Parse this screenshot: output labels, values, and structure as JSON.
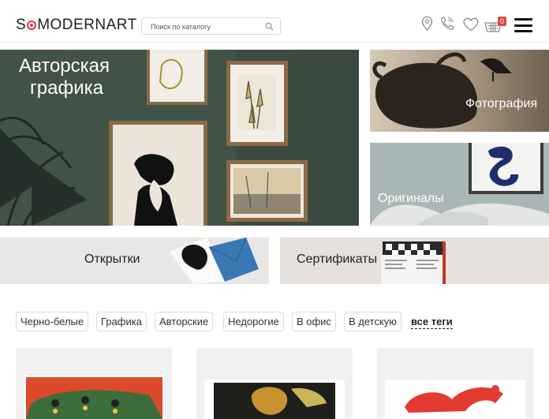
{
  "header": {
    "logo_pre": "S",
    "logo_post": "MODERNART",
    "search_placeholder": "Поиск по каталогу",
    "cart_count": "0",
    "icons": [
      "location-icon",
      "phone-icon",
      "heart-icon",
      "cart-icon",
      "menu-icon",
      "search-icon"
    ]
  },
  "banners": {
    "main_line1": "Авторская",
    "main_line2": "графика",
    "photo": "Фотография",
    "originals": "Оригиналы"
  },
  "cards": {
    "postcards": "Открытки",
    "certificates": "Сертификаты"
  },
  "tags": {
    "items": [
      "Черно-белые",
      "Графика",
      "Авторские",
      "Недорогие",
      "В офис",
      "В детскую"
    ],
    "all": "все теги"
  },
  "colors": {
    "accent": "#e0393e",
    "badge": "#d64a3b",
    "wall_green": "#3f4f44",
    "card_bg": "#ebe8e6"
  }
}
